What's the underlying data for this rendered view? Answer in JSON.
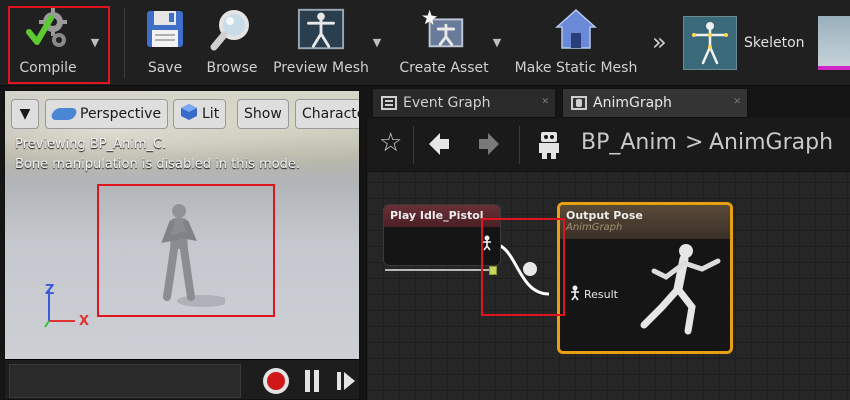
{
  "toolbar": {
    "compile_label": "Compile",
    "save_label": "Save",
    "browse_label": "Browse",
    "preview_mesh_label": "Preview Mesh",
    "create_asset_label": "Create Asset",
    "make_static_mesh_label": "Make Static Mesh",
    "overflow_glyph": "»",
    "skeleton_label": "Skeleton"
  },
  "viewport": {
    "perspective_label": "Perspective",
    "lit_label": "Lit",
    "show_label": "Show",
    "character_label": "Characte",
    "preview_message": "Previewing BP_Anim_C.",
    "bone_message": "Bone manipulation is disabled in this mode.",
    "axis_z": "Z",
    "axis_x": "X"
  },
  "tabs": [
    {
      "label": "Event Graph",
      "active": false
    },
    {
      "label": "AnimGraph",
      "active": true
    }
  ],
  "breadcrumb": {
    "asset": "BP_Anim",
    "separator": ">",
    "graph": "AnimGraph"
  },
  "nodes": {
    "play_node": {
      "title": "Play Idle_Pistol"
    },
    "output_node": {
      "title": "Output Pose",
      "subtitle": "AnimGraph",
      "pin_label": "Result"
    }
  },
  "colors": {
    "highlight_red": "#e0141e",
    "node_select_orange": "#e8a010",
    "compile_check_green": "#5cc832"
  }
}
